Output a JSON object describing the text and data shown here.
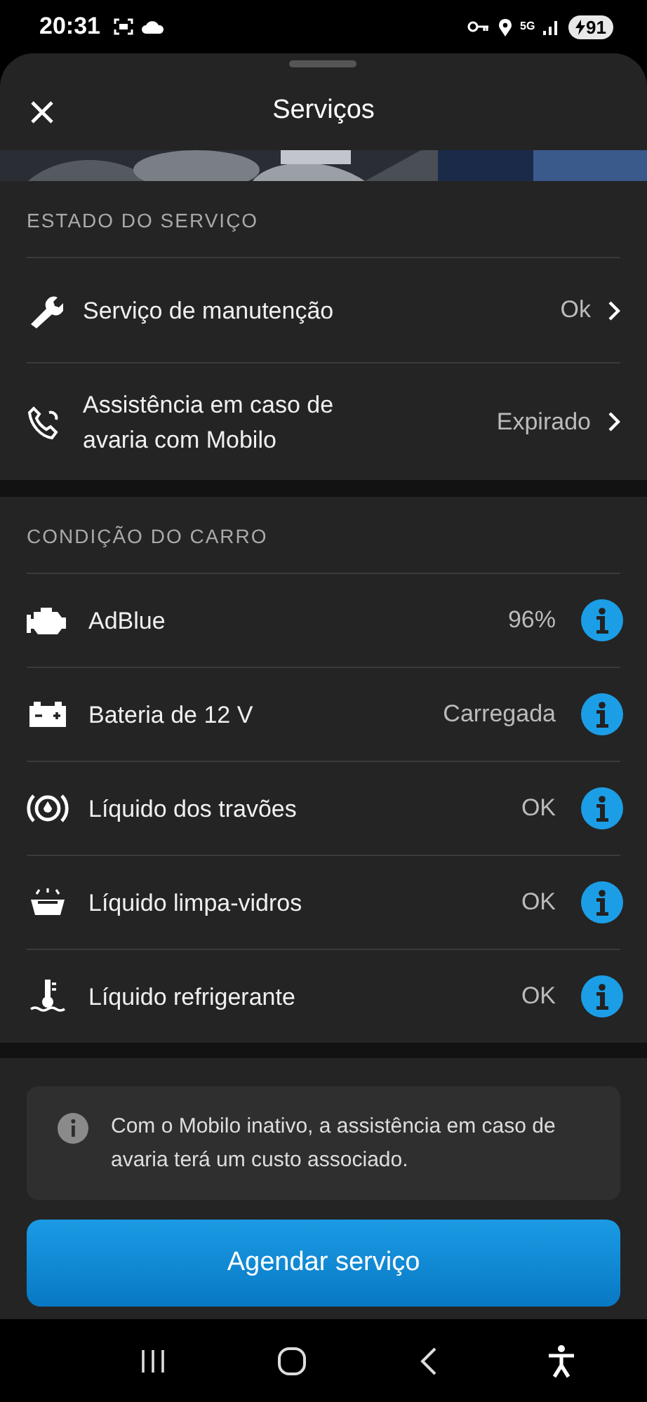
{
  "status_bar": {
    "time": "20:31",
    "network": "5G",
    "battery": "91"
  },
  "header": {
    "title": "Serviços"
  },
  "service_state": {
    "heading": "ESTADO DO SERVIÇO",
    "items": [
      {
        "label": "Serviço de manutenção",
        "value": "Ok"
      },
      {
        "label": "Assistência em caso de avaria com Mobilo",
        "value": "Expirado"
      }
    ]
  },
  "car_condition": {
    "heading": "CONDIÇÃO DO CARRO",
    "items": [
      {
        "label": "AdBlue",
        "value": "96%"
      },
      {
        "label": "Bateria de 12 V",
        "value": "Carregada"
      },
      {
        "label": "Líquido dos travões",
        "value": "OK"
      },
      {
        "label": "Líquido limpa-vidros",
        "value": "OK"
      },
      {
        "label": "Líquido refrigerante",
        "value": "OK"
      }
    ]
  },
  "notice": "Com o Mobilo inativo, a assistência em caso de avaria terá um custo associado.",
  "primary_button": "Agendar serviço"
}
